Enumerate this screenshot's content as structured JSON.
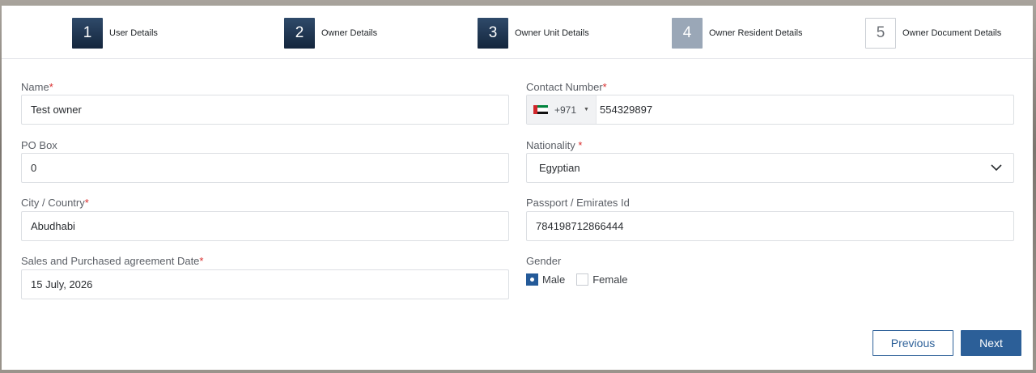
{
  "stepper": {
    "steps": [
      {
        "number": "1",
        "label": "User Details",
        "state": "active"
      },
      {
        "number": "2",
        "label": "Owner Details",
        "state": "active"
      },
      {
        "number": "3",
        "label": "Owner Unit Details",
        "state": "active"
      },
      {
        "number": "4",
        "label": "Owner Resident Details",
        "state": "pending"
      },
      {
        "number": "5",
        "label": "Owner Document Details",
        "state": "empty"
      }
    ]
  },
  "form": {
    "name": {
      "label": "Name",
      "required_mark": "*",
      "value": "Test owner"
    },
    "contact": {
      "label": "Contact Number",
      "required_mark": "*",
      "dial_code": "+971",
      "flag_icon": "uae-flag-icon",
      "value": "554329897"
    },
    "po_box": {
      "label": "PO Box",
      "value": "0"
    },
    "nationality": {
      "label": "Nationality",
      "required_mark": "*",
      "value": "Egyptian"
    },
    "city": {
      "label": "City / Country",
      "required_mark": "*",
      "value": "Abudhabi"
    },
    "passport": {
      "label": "Passport / Emirates Id",
      "value": "784198712866444"
    },
    "agreement_date": {
      "label": "Sales and Purchased agreement Date",
      "required_mark": "*",
      "value": "15 July, 2026"
    },
    "gender": {
      "label": "Gender",
      "options": [
        "Male",
        "Female"
      ],
      "selected": "Male"
    }
  },
  "actions": {
    "previous_label": "Previous",
    "next_label": "Next"
  },
  "colors": {
    "primary": "#2c5f98",
    "step_active": "#1b2f48",
    "step_pending": "#9aa7b7",
    "required": "#d92b2b"
  }
}
